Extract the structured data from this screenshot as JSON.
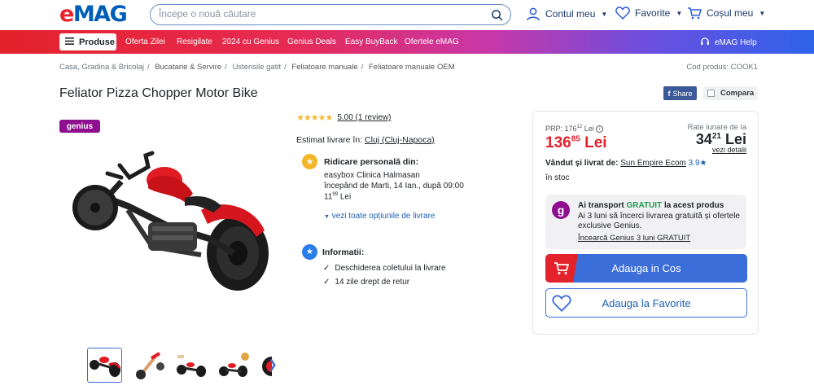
{
  "header": {
    "logo_text": "eMAG",
    "search_placeholder": "Începe o nouă căutare",
    "account_label": "Contul meu",
    "favorites_label": "Favorite",
    "cart_label": "Coșul meu"
  },
  "nav": {
    "produse_label": "Produse",
    "items": [
      "Oferta Zilei",
      "Resigilate",
      "2024 cu Genius",
      "Genius Deals",
      "Easy BuyBack",
      "Ofertele eMAG"
    ],
    "help_label": "eMAG Help"
  },
  "breadcrumb": [
    "Casa, Gradina & Bricolaj",
    "Bucatarie & Servire",
    "Ustensile gatit",
    "Feliatoare manuale",
    "Feliatoare manuale OEM"
  ],
  "product_code": "Cod produs: COOK1",
  "product": {
    "title": "Feliator Pizza Chopper Motor Bike",
    "share_label": "Share",
    "compare_label": "Compara",
    "genius_badge": "genius",
    "rating_stars": "★★★★★",
    "rating_text": "5.00 (1 review)"
  },
  "delivery": {
    "estimate_prefix": "Estimat livrare în:",
    "location": "Cluj (Cluj-Napoca)",
    "pickup_title": "Ridicare personală din:",
    "pickup_place": "easybox Clinica Halmasan",
    "pickup_when": "începând de Marti, 14 Ian., după 09:00",
    "pickup_price_int": "11",
    "pickup_price_dec": "99",
    "pickup_currency": "Lei",
    "all_options": "vezi toate opțiunile de livrare"
  },
  "info": {
    "title": "Informatii:",
    "items": [
      "Deschiderea coletului la livrare",
      "14 zile drept de retur"
    ]
  },
  "buybox": {
    "prp_label": "PRP:",
    "prp_int": "176",
    "prp_dec": "12",
    "prp_currency": "Lei",
    "price_int": "136",
    "price_dec": "85",
    "price_currency": "Lei",
    "rate_label": "Rate lunare de la",
    "rate_int": "34",
    "rate_dec": "21",
    "rate_currency": "Lei",
    "rate_more": "vezi detalii",
    "seller_prefix": "Vândut și livrat de:",
    "seller_name": "Sun Empire Ecom",
    "seller_rating": "3.9",
    "stock": "în stoc",
    "genius_title_a": "Ai transport",
    "genius_title_b": "GRATUIT",
    "genius_title_c": "la acest produs",
    "genius_desc": "Ai 3 luni să încerci livrarea gratuită și ofertele exclusive Genius.",
    "genius_cta": "Încearcă Genius 3 luni GRATUIT",
    "cart_button": "Adauga in Cos",
    "fav_button": "Adauga la Favorite"
  },
  "colors": {
    "brand_blue": "#005eb8",
    "brand_red": "#e9222c",
    "price_red": "#e3212b",
    "button_blue": "#3c6ed9",
    "genius_purple": "#8e0e8e"
  }
}
